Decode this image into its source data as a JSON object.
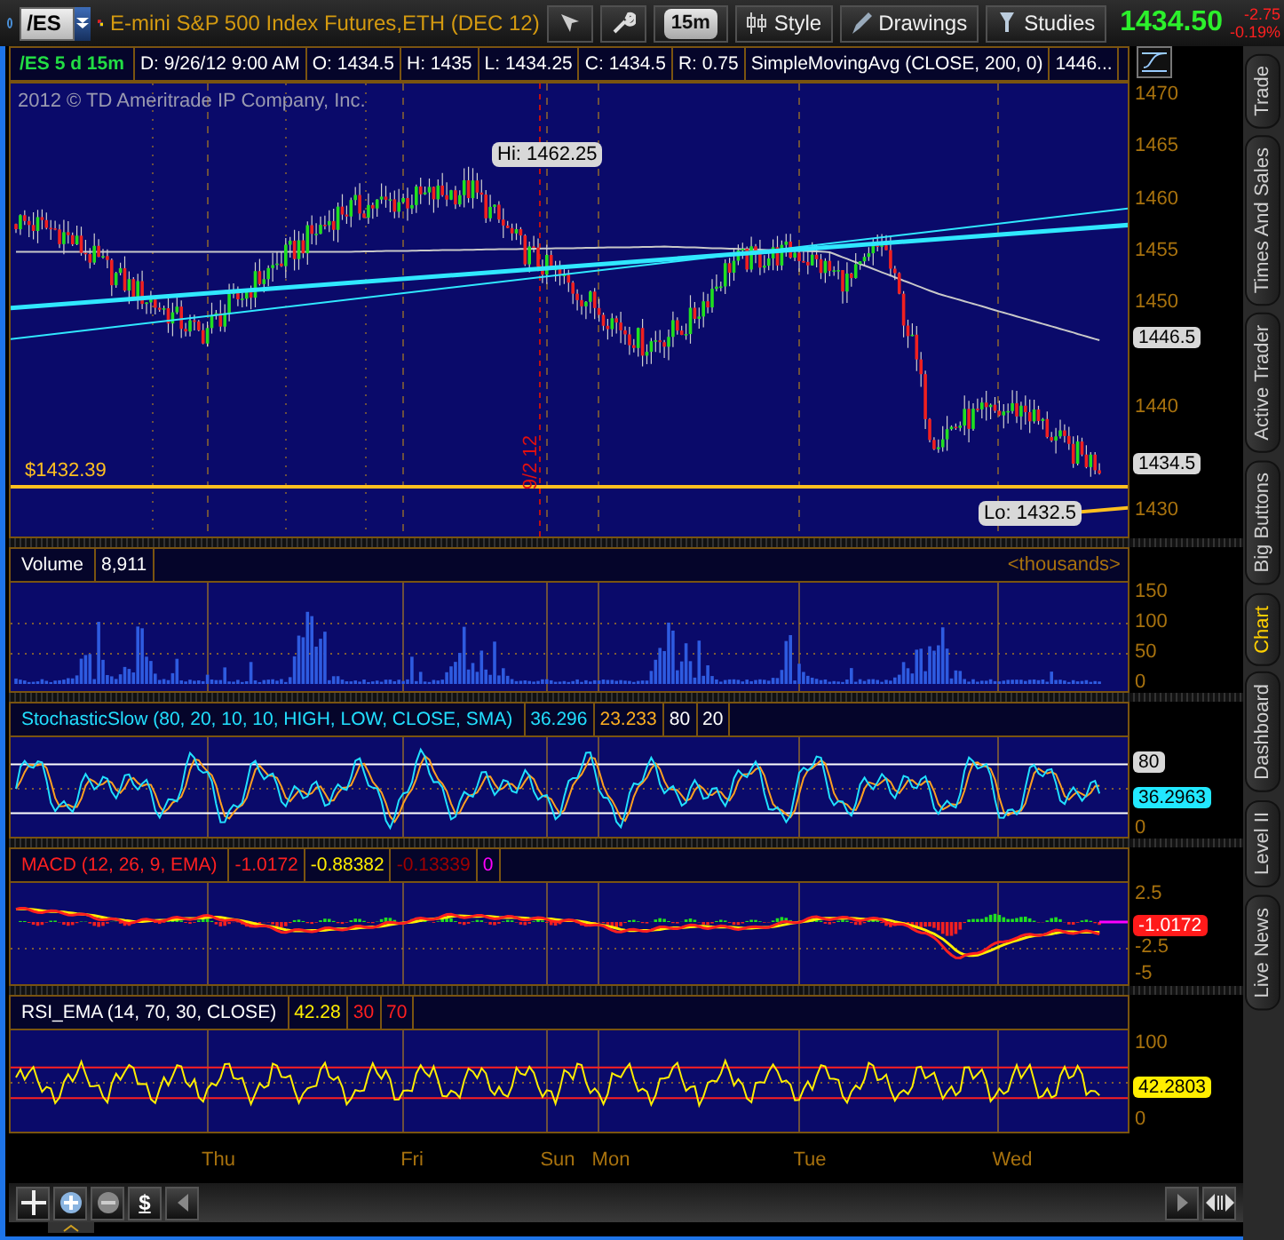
{
  "toolbar": {
    "symbol": "/ES",
    "title": "E-mini S&P 500 Index Futures,ETH (DEC 12)",
    "timeframe": "15m",
    "buttons": [
      "Style",
      "Drawings",
      "Studies"
    ],
    "last": "1434.50",
    "change": "-2.75",
    "change_pct": "-0.19%"
  },
  "info_bar": [
    "/ES 5 d 15m",
    "D: 9/26/12 9:00 AM",
    "O: 1434.5",
    "H: 1435",
    "L: 1434.25",
    "C: 1434.5",
    "R: 0.75",
    "SimpleMovingAvg (CLOSE, 200, 0)",
    "1446..."
  ],
  "price_panel": {
    "copyright": "2012 © TD Ameritrade IP Company, Inc.",
    "high_label": "Hi: 1462.25",
    "low_label": "Lo: 1432.5",
    "alert_label": "$1432.39",
    "date_marker": "9/2 12",
    "axis": [
      "1470",
      "1465",
      "1460",
      "1455",
      "1450",
      "1440",
      "1430"
    ],
    "badges": [
      "1446.5",
      "1434.5"
    ]
  },
  "studies": [
    {
      "kind": "volume",
      "title": "Volume",
      "values": [
        "8,911"
      ],
      "note": "<thousands>",
      "axis": [
        "150",
        "100",
        "50",
        "0"
      ]
    },
    {
      "kind": "stochastic",
      "title": "StochasticSlow (80, 20, 10, 10, HIGH, LOW, CLOSE, SMA)",
      "values": [
        "36.296",
        "23.233",
        "80",
        "20"
      ],
      "axis": [
        "0"
      ],
      "badges": [
        "80",
        "36.2963"
      ]
    },
    {
      "kind": "macd",
      "title": "MACD (12, 26, 9, EMA)",
      "values": [
        "-1.0172",
        "-0.88382",
        "-0.13339",
        "0"
      ],
      "axis": [
        "2.5",
        "-2.5",
        "-5"
      ],
      "badges": [
        "-1.0172"
      ]
    },
    {
      "kind": "rsi",
      "title": "RSI_EMA (14, 70, 30, CLOSE)",
      "values": [
        "42.28",
        "30",
        "70"
      ],
      "axis": [
        "100",
        "0"
      ],
      "badges": [
        "42.2803"
      ]
    }
  ],
  "time_axis": [
    "Thu",
    "Fri",
    "Sun",
    "Mon",
    "Tue",
    "Wed"
  ],
  "bottom_toolbar": {
    "currency": "$"
  },
  "side_tabs": [
    {
      "label": "Trade",
      "selected": false
    },
    {
      "label": "Times And Sales",
      "selected": false
    },
    {
      "label": "Active Trader",
      "selected": false
    },
    {
      "label": "Big Buttons",
      "selected": false
    },
    {
      "label": "Chart",
      "selected": true
    },
    {
      "label": "Dashboard",
      "selected": false
    },
    {
      "label": "Level II",
      "selected": false
    },
    {
      "label": "Live News",
      "selected": false
    }
  ]
}
